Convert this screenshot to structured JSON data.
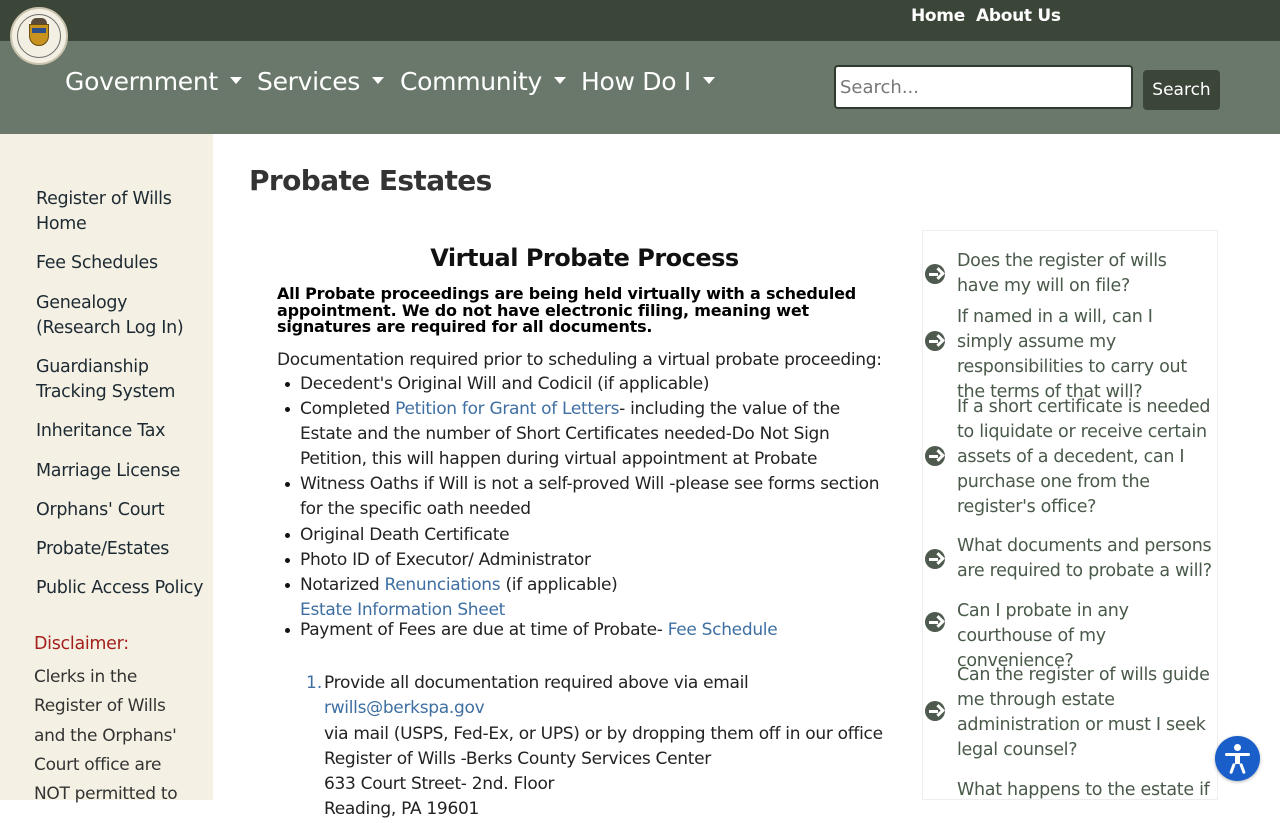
{
  "colors": {
    "topbar": "#3b4538",
    "nav": "#69786a",
    "sidebar": "#f4f0e3",
    "link": "#3f6fa2",
    "disclaimer": "#a3201c",
    "a11y": "#1a5ec9"
  },
  "topbar": {
    "home": "Home",
    "about": "About Us",
    "logo_icon": "county-seal-icon"
  },
  "nav": {
    "items": [
      "Government",
      "Services",
      "Community",
      "How Do I"
    ]
  },
  "search": {
    "placeholder": "Search...",
    "button": "Search"
  },
  "sidebar": {
    "items": [
      "Register of Wills Home",
      "Fee Schedules",
      "Genealogy (Research Log In)",
      "Guardianship Tracking System",
      "Inheritance Tax",
      "Marriage License",
      "Orphans' Court",
      "Probate/Estates",
      "Public Access Policy"
    ],
    "disclaimer_title": "Disclaimer:",
    "disclaimer_text": "Clerks in the Register of Wills and the Orphans' Court office are NOT permitted to"
  },
  "content": {
    "page_title": "Probate Estates",
    "section_title": "Virtual Probate Process",
    "notice": "All Probate proceedings are being held virtually with a scheduled appointment. We do not have electronic filing, meaning wet signatures are required for all documents.",
    "intro": "Documentation required prior to scheduling a virtual probate proceeding:",
    "bullets": {
      "b1": "Decedent's Original Will and Codicil (if applicable)",
      "b2_pre": "Completed ",
      "b2_link": "Petition for Grant of Letters",
      "b2_post": "- including the value of the Estate and the number of Short Certificates needed-Do Not Sign Petition, this will happen during virtual appointment at Probate",
      "b3": "Witness Oaths if Will is not a self-proved Will -please see forms section for the specific oath needed",
      "b4": "Original Death Certificate",
      "b5": "Photo ID of Executor/ Administrator",
      "b6_pre": "Notarized ",
      "b6_link": "Renunciations",
      "b6_post": " (if applicable)",
      "b7_link": "Estate Information Sheet",
      "b8_pre": "Payment of Fees are due at time of Probate- ",
      "b8_link": "Fee Schedule"
    },
    "step1": {
      "num": "1.",
      "pre": "Provide all documentation required above via email ",
      "email": "rwills@berkspa.gov",
      "post": " via mail (USPS, Fed-Ex, or UPS) or by dropping them off in our office",
      "office": "Register of Wills -Berks County Services Center",
      "street": "633 Court Street- 2nd. Floor",
      "city": "Reading, PA 19601"
    }
  },
  "faq": [
    "Does the register of wills have my will on file?",
    "If named in a will, can I simply assume my responsibilities to carry out the terms of that will?",
    "If a short certificate is needed to liquidate or receive certain assets of a decedent, can I purchase one from the register's office?",
    "What documents and persons are required to probate a will?",
    "Can I probate in any courthouse of my convenience?",
    "Can the register of wills guide me through estate administration or must I seek legal counsel?",
    "What happens to the estate if"
  ]
}
